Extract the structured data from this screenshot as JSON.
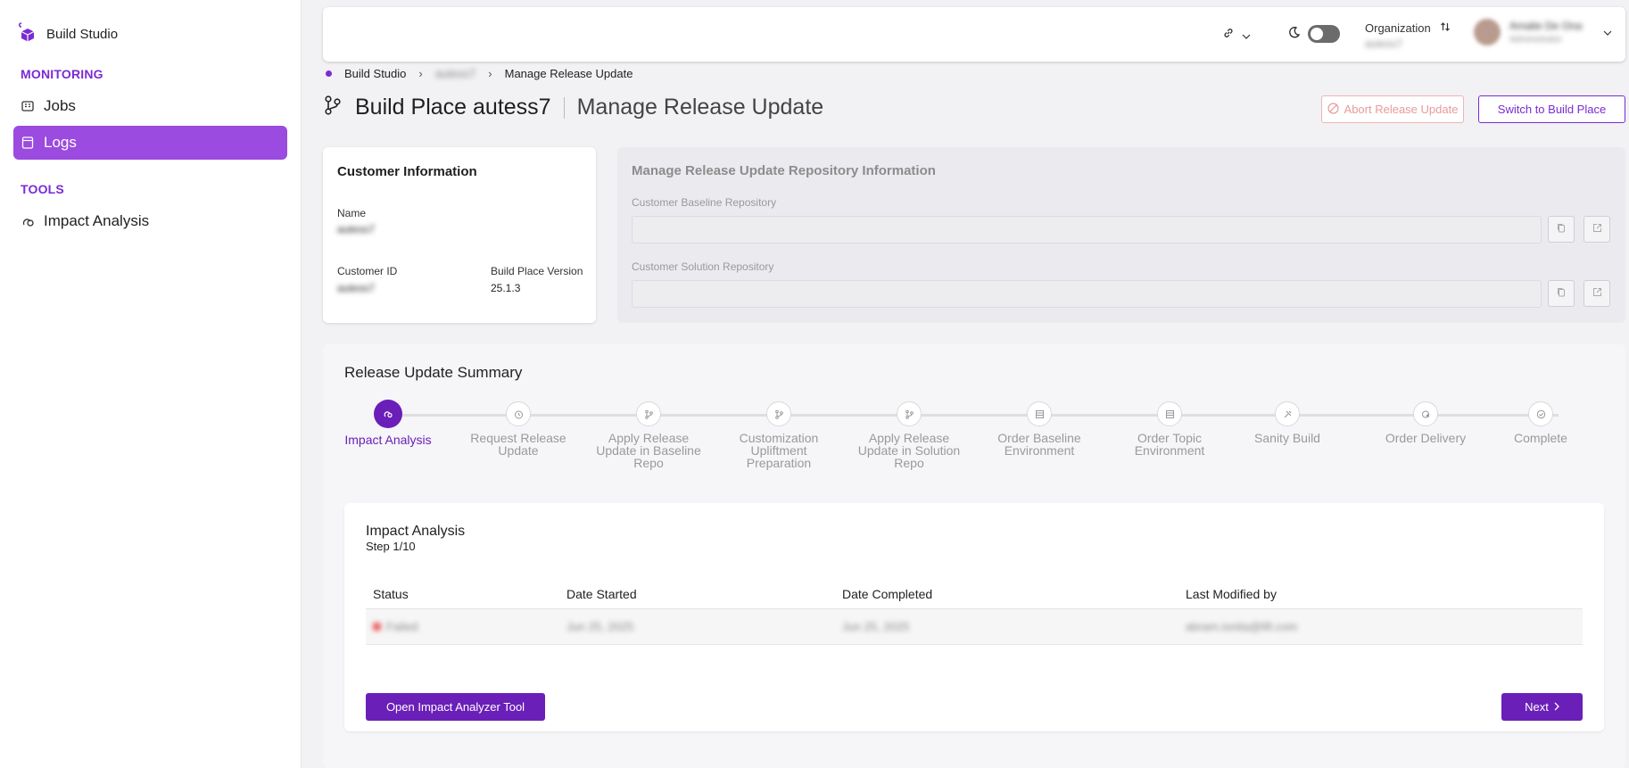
{
  "app": {
    "name": "Build Studio",
    "accent": "#7a2bd4"
  },
  "sidebar": {
    "sections": [
      {
        "label": "MONITORING",
        "items": [
          {
            "label": "Jobs",
            "icon": "jobs-icon"
          },
          {
            "label": "Logs",
            "icon": "logs-icon",
            "active": true
          }
        ]
      },
      {
        "label": "TOOLS",
        "items": [
          {
            "label": "Impact Analysis",
            "icon": "impact-analysis-icon"
          }
        ]
      }
    ]
  },
  "header": {
    "org_label": "Organization",
    "org_value": "autess7",
    "user_name": "Amalie De Ona",
    "user_role": "Administrator"
  },
  "breadcrumb": {
    "root": "Build Studio",
    "middle": "autess7",
    "current": "Manage Release Update"
  },
  "page": {
    "title": "Build Place autess7",
    "subtitle": "Manage Release Update",
    "abort_label": "Abort Release Update",
    "switch_label": "Switch to Build Place"
  },
  "customer": {
    "title": "Customer Information",
    "name_label": "Name",
    "name_value": "autess7",
    "id_label": "Customer ID",
    "id_value": "autess7",
    "version_label": "Build Place Version",
    "version_value": "25.1.3"
  },
  "repo": {
    "title": "Manage Release Update Repository Information",
    "baseline_label": "Customer Baseline Repository",
    "solution_label": "Customer Solution Repository"
  },
  "summary": {
    "title": "Release Update Summary",
    "steps": [
      {
        "label": "Impact Analysis",
        "active": true
      },
      {
        "label": "Request Release Update"
      },
      {
        "label": "Apply Release Update in Baseline Repo"
      },
      {
        "label": "Customization Upliftment Preparation"
      },
      {
        "label": "Apply Release Update in Solution Repo"
      },
      {
        "label": "Order Baseline Environment"
      },
      {
        "label": "Order Topic Environment"
      },
      {
        "label": "Sanity Build"
      },
      {
        "label": "Order Delivery"
      },
      {
        "label": "Complete"
      }
    ]
  },
  "impact": {
    "title": "Impact Analysis",
    "step_text": "Step 1/10",
    "columns": [
      "Status",
      "Date Started",
      "Date Completed",
      "Last Modified by"
    ],
    "row": {
      "status": "Failed",
      "started": "Jun 25, 2025",
      "completed": "Jun 25, 2025",
      "modified_by": "abram.ionita@lifi.com"
    },
    "open_tool_label": "Open Impact Analyzer Tool",
    "next_label": "Next"
  }
}
